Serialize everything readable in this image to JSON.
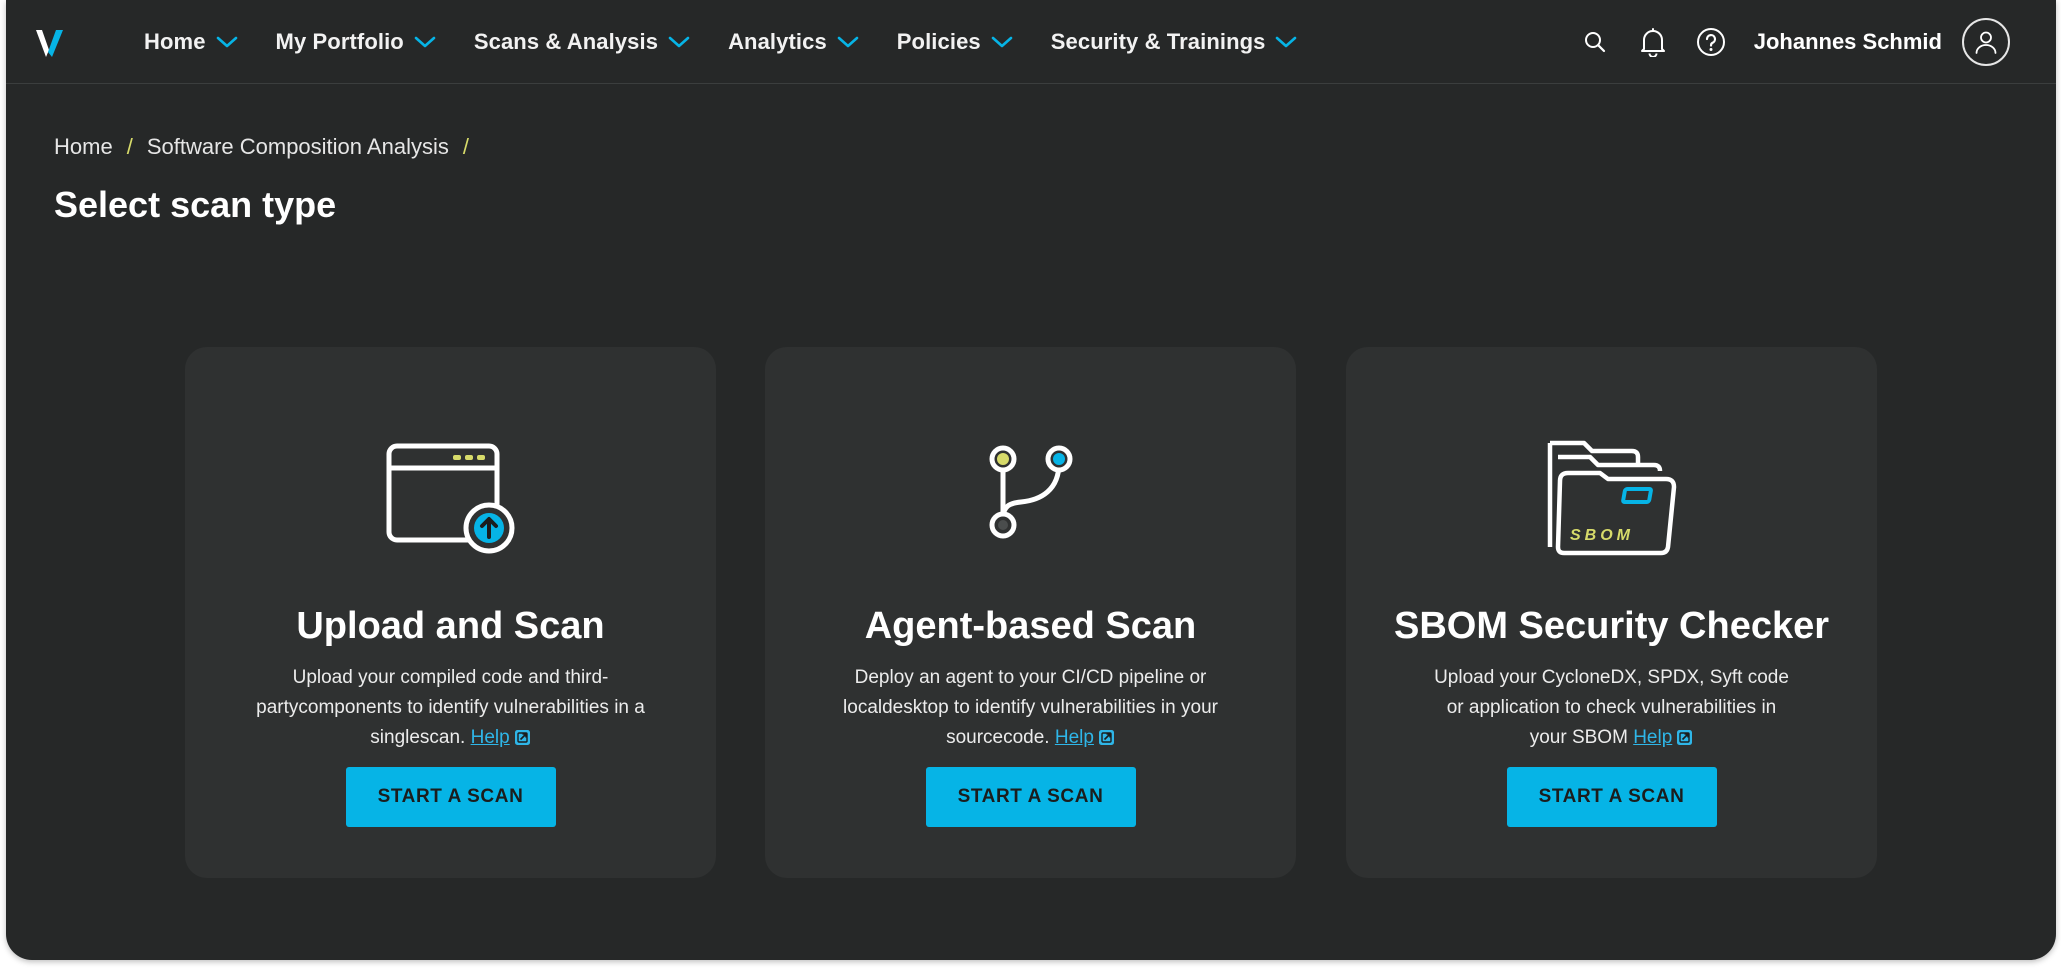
{
  "nav": {
    "items": [
      {
        "label": "Home"
      },
      {
        "label": "My Portfolio"
      },
      {
        "label": "Scans & Analysis"
      },
      {
        "label": "Analytics"
      },
      {
        "label": "Policies"
      },
      {
        "label": "Security & Trainings"
      }
    ]
  },
  "header": {
    "user_name": "Johannes Schmid",
    "icons": [
      "search-icon",
      "bell-icon",
      "help-icon",
      "user-avatar-icon"
    ]
  },
  "breadcrumb": {
    "items": [
      "Home",
      "Software Composition Analysis"
    ],
    "separator": "/"
  },
  "page": {
    "title": "Select scan type"
  },
  "cards": [
    {
      "title": "Upload and Scan",
      "desc_line1": "Upload your compiled code and third-",
      "desc_line2": "partycomponents to identify vulnerabilities in a",
      "desc_line3": "singlescan.",
      "help": "Help",
      "button": "START A SCAN",
      "icon": "browser-upload-icon"
    },
    {
      "title": "Agent-based Scan",
      "desc_line1": "Deploy an agent to your CI/CD pipeline or",
      "desc_line2": "localdesktop to identify vulnerabilities in your",
      "desc_line3": "sourcecode.",
      "help": "Help",
      "button": "START A SCAN",
      "icon": "git-branch-icon"
    },
    {
      "title": "SBOM Security Checker",
      "desc_line1": "Upload your CycloneDX, SPDX, Syft code",
      "desc_line2": "or application to check vulnerabilities in",
      "desc_line3": "your SBOM",
      "help": "Help",
      "button": "START A SCAN",
      "icon": "sbom-folder-icon",
      "icon_text": "SBOM"
    }
  ],
  "colors": {
    "background": "#262828",
    "card": "#2f3131",
    "accent": "#06b4e6",
    "highlight": "#d7db6a",
    "link": "#2fb6e8"
  }
}
